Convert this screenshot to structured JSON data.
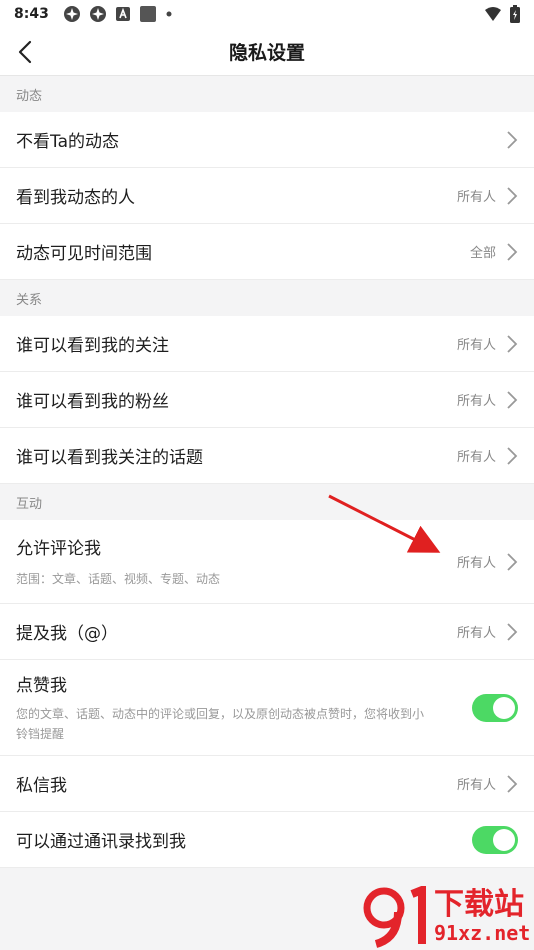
{
  "statusbar": {
    "time": "8:43"
  },
  "header": {
    "title": "隐私设置"
  },
  "sections": [
    {
      "title": "动态",
      "rows": [
        {
          "label": "不看Ta的动态",
          "value": ""
        },
        {
          "label": "看到我动态的人",
          "value": "所有人"
        },
        {
          "label": "动态可见时间范围",
          "value": "全部"
        }
      ]
    },
    {
      "title": "关系",
      "rows": [
        {
          "label": "谁可以看到我的关注",
          "value": "所有人"
        },
        {
          "label": "谁可以看到我的粉丝",
          "value": "所有人"
        },
        {
          "label": "谁可以看到我关注的话题",
          "value": "所有人"
        }
      ]
    },
    {
      "title": "互动",
      "rows": [
        {
          "label": "允许评论我",
          "desc": "范围：文章、话题、视频、专题、动态",
          "value": "所有人"
        },
        {
          "label": "提及我（@）",
          "value": "所有人"
        },
        {
          "label": "点赞我",
          "desc": "您的文章、话题、动态中的评论或回复，以及原创动态被点赞时，您将收到小铃铛提醒",
          "toggle": true
        },
        {
          "label": "私信我",
          "value": "所有人"
        },
        {
          "label": "可以通过通讯录找到我",
          "toggle": true
        }
      ]
    }
  ],
  "watermark": {
    "text": "下载站",
    "domain": "91xz.net"
  },
  "colors": {
    "toggle_on": "#4cd964",
    "annotation_arrow": "#e02020",
    "watermark": "#e3242b"
  }
}
